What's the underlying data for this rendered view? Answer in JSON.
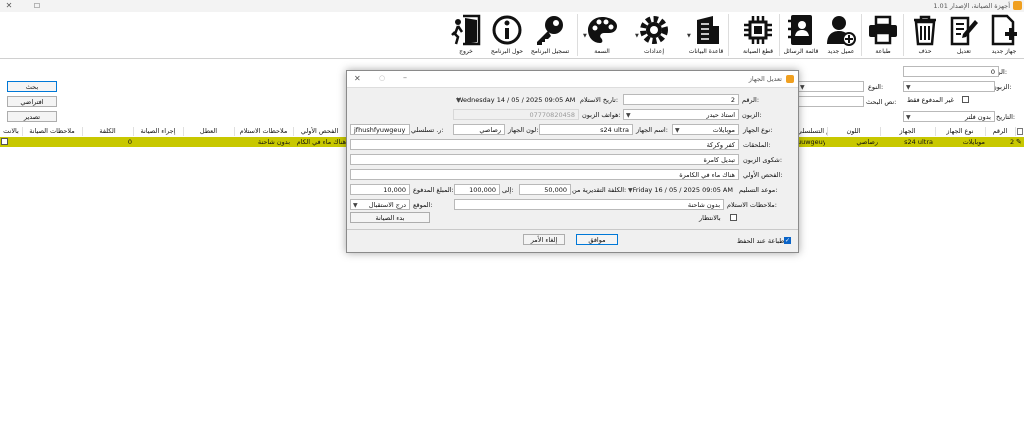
{
  "window": {
    "title": "أجهزة الصيانة، الإصدار 1.01",
    "controls": {
      "minimize": "—",
      "maximize": "☐",
      "close": "✕"
    }
  },
  "toolbar": {
    "new": "جهاز جديد",
    "edit": "تعديل",
    "delete": "حذف",
    "print": "طباعة",
    "new_customer": "عميل جديد",
    "messages": "قائمة الرسائل",
    "spare_parts": "قطع الصيانة",
    "database": "قاعدة البيانات",
    "settings": "إعدادات",
    "theme": "السمة",
    "register": "تسجيل البرنامج",
    "about": "حول البرنامج",
    "exit": "خروج"
  },
  "filters": {
    "number_label": "الرقم:",
    "number_value": "0",
    "customer_label": "الزبون:",
    "type_label": "النوع:",
    "paid_only_label": "غير المدفوع فقط",
    "search_text_label": "نص البحث:",
    "date_label": "التاريخ:",
    "date_value": "بدون فلتر",
    "search_button": "بحث",
    "default_button": "افتراضي",
    "export_button": "تصدير"
  },
  "grid": {
    "columns": [
      "الرقم",
      "نوع الجهاز",
      "الجهاز",
      "اللون",
      "الرقم التسلسلي",
      "الفحص الأولي",
      "ملاحظات الاستلام",
      "العطل",
      "إجراء الصيانة",
      "الكلفة",
      "ملاحظات الصيانة",
      "بالانت"
    ],
    "row": {
      "number": "2",
      "type": "موبايلات",
      "device": "s24 ultra",
      "color": "رصاصي",
      "serial": "uuwgeuy",
      "initial_check": "هناك ماء في الكام",
      "receipt_notes": "بدون شاحنة",
      "fault": "",
      "maintenance_action": "",
      "cost": "0",
      "maintenance_notes": ""
    }
  },
  "dialog": {
    "title": "تعديل الجهاز",
    "number_label": "الرقم:",
    "number_value": "2",
    "receipt_date_label": "تاريخ الاستلام:",
    "receipt_date_value": "Wednesday 14 / 05 / 2025 09:05 AM",
    "customer_label": "الزبون:",
    "customer_value": "استاذ حيدر",
    "customer_phone_label": "هواتف الزبون:",
    "customer_phone_value": "07770820458",
    "device_type_label": "نوع الجهاز:",
    "device_type_value": "موبايلات",
    "device_name_label": "اسم الجهاز:",
    "device_name_value": "s24 ultra",
    "device_color_label": "لون الجهاز:",
    "device_color_value": "رصاصي",
    "serial_label": "ر. تسلسلي:",
    "serial_value": "jfhushfyuwgeuy",
    "accessories_label": "الملحقات:",
    "accessories_value": "كفر وكركة",
    "complaint_label": "شكوى الزبون:",
    "complaint_value": "تبديل كامرة",
    "initial_check_label": "الفحص الأولي:",
    "initial_check_value": "هناك ماء في الكامرة",
    "delivery_date_label": "موعد التسليم:",
    "delivery_date_value": "Friday 16 / 05 / 2025 09:05 AM",
    "estimated_cost_label": "الكلفة التقديرية من:",
    "estimated_cost_from": "50,000",
    "to_label": "إلى:",
    "estimated_cost_to": "100,000",
    "paid_label": "المبلغ المدفوع:",
    "paid_value": "10,000",
    "receipt_notes_label": "ملاحظات الاستلام:",
    "receipt_notes_value": "بدون شاحنة",
    "location_label": "الموقع:",
    "location_value": "درج الاستقبال",
    "waiting_label": "بالانتظار",
    "start_maintenance_button": "بدء الصيانة",
    "print_on_save_label": "طباعة عند الحفظ",
    "ok_button": "موافق",
    "cancel_button": "إلغاء الأمر"
  }
}
